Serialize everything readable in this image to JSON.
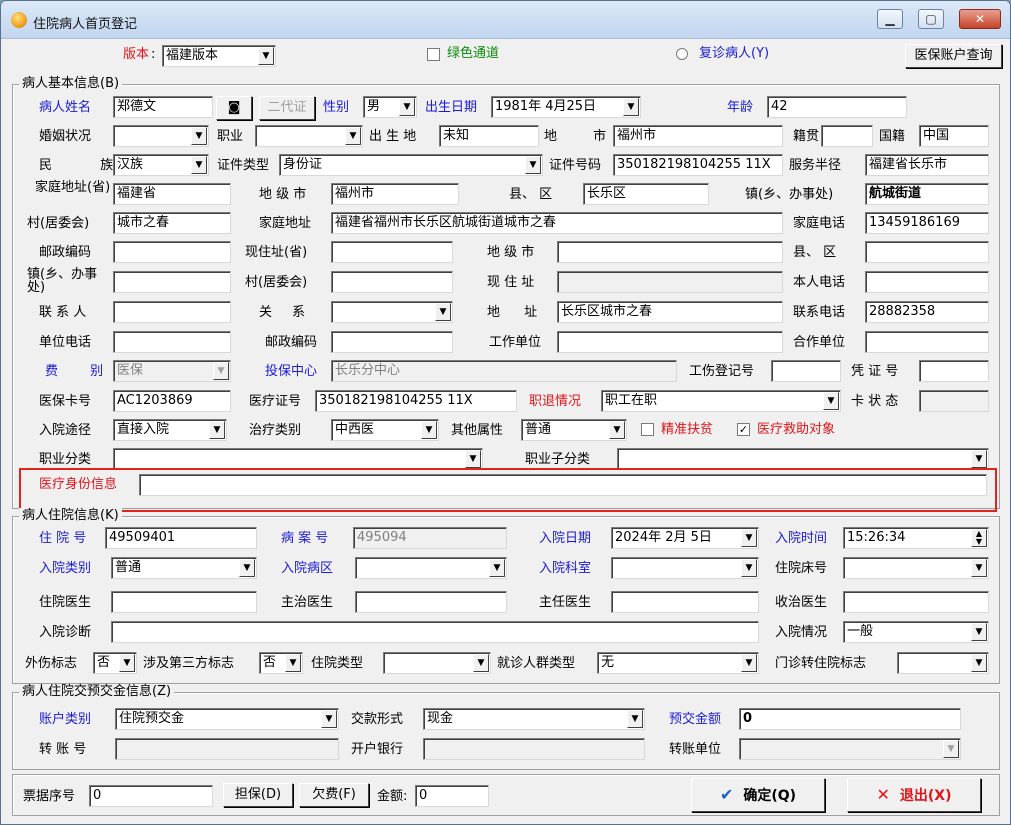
{
  "window": {
    "title": "住院病人首页登记",
    "min": "▁",
    "max": "▢",
    "close": "✕"
  },
  "top": {
    "version_label": "版本",
    "version_value": "福建版本",
    "green_channel": "绿色通道",
    "revisit": "复诊病人(Y)",
    "medical_account_btn": "医保账户查询"
  },
  "basic": {
    "title": "病人基本信息(B)",
    "name_label": "病人姓名",
    "name": "郑德文",
    "card_btn": "二代证",
    "gender_label": "性别",
    "gender": "男",
    "birth_label": "出生日期",
    "birth": "1981年 4月25日",
    "age_label": "年龄",
    "age": "42",
    "marital_label": "婚姻状况",
    "marital": "",
    "job_label": "职业",
    "job": "",
    "birthplace_label": "出 生 地",
    "birthplace": "未知",
    "city_label": "地 市",
    "city": "福州市",
    "native_label": "籍贯",
    "native": "",
    "nation_label": "国籍",
    "nation": "中国",
    "ethnic_label": "民 族",
    "ethnic": "汉族",
    "idtype_label": "证件类型",
    "idtype": "身份证",
    "idno_label": "证件号码",
    "idno": "350182198104255 11X",
    "service_label": "服务半径",
    "service": "福建省长乐市",
    "home_prov_label": "家庭地址(省)",
    "home_prov": "福建省",
    "home_city_label": "地 级 市",
    "home_city": "福州市",
    "county_label": "县、 区",
    "county": "长乐区",
    "town_label": "镇(乡、办事处)",
    "town": "航城街道",
    "village_label": "村(居委会)",
    "village": "城市之春",
    "home_addr_label": "家庭地址",
    "home_addr": "福建省福州市长乐区航城街道城市之春",
    "home_phone_label": "家庭电话",
    "home_phone": "13459186169",
    "postcode_label": "邮政编码",
    "postcode": "",
    "cur_prov_label": "现住址(省)",
    "cur_prov": "",
    "cur_city_label": "地 级 市",
    "cur_city": "",
    "cur_county_label": "县、 区",
    "cur_county": "",
    "cur_town_label": "镇(乡、办事处)",
    "cur_town": "",
    "cur_village_label": "村(居委会)",
    "cur_village": "",
    "cur_addr_label": "现 住 址",
    "cur_addr": "",
    "self_phone_label": "本人电话",
    "self_phone": "",
    "contact_label": "联 系 人",
    "contact": "",
    "relation_label": "关 系",
    "relation": "",
    "addr_label": "地 址",
    "addr": "长乐区城市之春",
    "contact_phone_label": "联系电话",
    "contact_phone": "28882358",
    "work_phone_label": "单位电话",
    "work_phone": "",
    "work_post_label": "邮政编码",
    "work_post": "",
    "work_unit_label": "工作单位",
    "work_unit": "",
    "coop_label": "合作单位",
    "coop": "",
    "fee_label": "费 别",
    "fee": "医保",
    "insure_label": "投保中心",
    "insure": "长乐分中心",
    "injury_label": "工伤登记号",
    "injury": "",
    "voucher_label": "凭 证 号",
    "voucher": "",
    "mcard_label": "医保卡号",
    "mcard": "AC1203869",
    "mcert_label": "医疗证号",
    "mcert": "350182198104255 11X",
    "retire_label": "职退情况",
    "retire": "职工在职",
    "cardstate_label": "卡 状 态",
    "cardstate": "",
    "route_label": "入院途径",
    "route": "直接入院",
    "treat_label": "治疗类别",
    "treat": "中西医",
    "other_label": "其他属性",
    "other": "普通",
    "poverty": "精准扶贫",
    "aid": "医疗救助对象",
    "occ_label": "职业分类",
    "occ": "",
    "subocc_label": "职业子分类",
    "subocc": "",
    "identity_label": "医疗身份信息",
    "identity": ""
  },
  "stay": {
    "title": "病人住院信息(K)",
    "no_label": "住 院 号",
    "no": "49509401",
    "case_label": "病 案 号",
    "case": "495094",
    "date_label": "入院日期",
    "date": "2024年 2月 5日",
    "time_label": "入院时间",
    "time": "15:26:34",
    "type_label": "入院类别",
    "type": "普通",
    "ward_label": "入院病区",
    "ward": "",
    "dept_label": "入院科室",
    "dept": "",
    "bed_label": "住院床号",
    "bed": "",
    "doc_label": "住院医生",
    "doc": "",
    "attend_label": "主治医生",
    "attend": "",
    "chief_label": "主任医生",
    "chief": "",
    "admit_label": "收治医生",
    "admit": "",
    "diag_label": "入院诊断",
    "diag": "",
    "cond_label": "入院情况",
    "cond": "一般",
    "injury_label": "外伤标志",
    "injury": "否",
    "third_label": "涉及第三方标志",
    "third": "否",
    "kind_label": "住院类型",
    "kind": "",
    "crowd_label": "就诊人群类型",
    "crowd": "无",
    "trans_label": "门诊转住院标志",
    "trans": ""
  },
  "deposit": {
    "title": "病人住院交预交金信息(Z)",
    "acct_label": "账户类别",
    "acct": "住院预交金",
    "pay_label": "交款形式",
    "pay": "现金",
    "amount_label": "预交金额",
    "amount": "0",
    "transfer_label": "转 账 号",
    "transfer": "",
    "bank_label": "开户银行",
    "bank": "",
    "tunit_label": "转账单位",
    "tunit": ""
  },
  "bottom": {
    "ticket_label": "票据序号",
    "ticket": "0",
    "guarantee": "担保(D)",
    "owe": "欠费(F)",
    "money_label": "金额:",
    "money": "0",
    "ok": "确定(Q)",
    "exit": "退出(X)"
  }
}
